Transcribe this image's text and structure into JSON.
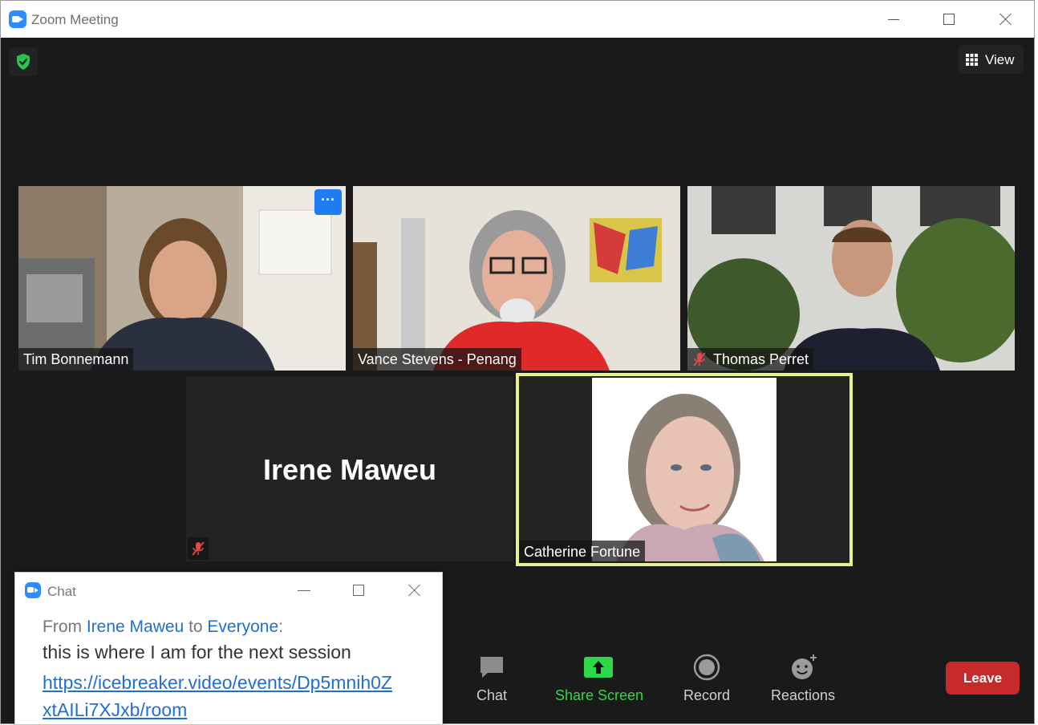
{
  "window": {
    "title": "Zoom Meeting"
  },
  "top_controls": {
    "view_label": "View"
  },
  "participants": [
    {
      "name": "Tim Bonnemann",
      "muted": false
    },
    {
      "name": "Vance Stevens - Penang",
      "muted": false
    },
    {
      "name": "Thomas Perret",
      "muted": true
    },
    {
      "name": "Irene Maweu",
      "muted": true,
      "video_off": true
    },
    {
      "name": "Catherine Fortune",
      "muted": false,
      "active_speaker": true
    }
  ],
  "more_menu_glyph": "···",
  "chat": {
    "title": "Chat",
    "from_prefix": "From ",
    "sender": "Irene Maweu",
    "to_word": " to ",
    "recipient": "Everyone",
    "colon": ":",
    "message": "this is where I am for the next session",
    "link": "https://icebreaker.video/events/Dp5mnih0ZxtAILi7XJxb/room"
  },
  "toolbar": {
    "chat_label": "Chat",
    "share_label": "Share Screen",
    "record_label": "Record",
    "reactions_label": "Reactions",
    "leave_label": "Leave"
  },
  "colors": {
    "zoom_blue": "#2D8CFF",
    "share_green": "#2fd84a",
    "leave_red": "#c62a2a",
    "speaker_border": "#e9f28a",
    "mute_red": "#e0484d"
  }
}
